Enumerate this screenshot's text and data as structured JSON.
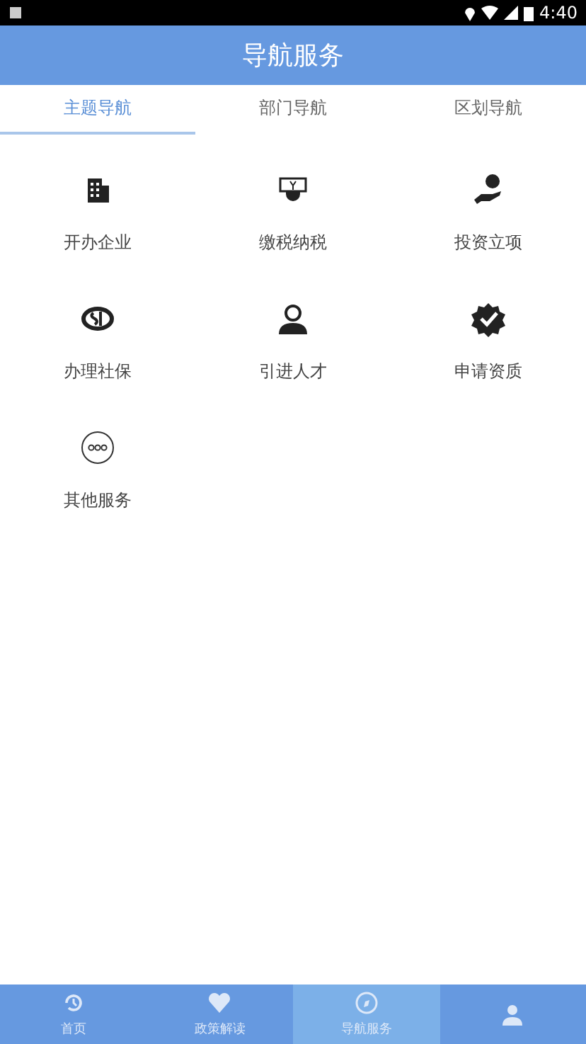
{
  "status_bar": {
    "time": "4:40"
  },
  "header": {
    "title": "导航服务"
  },
  "tabs": [
    {
      "label": "主题导航",
      "selected": true
    },
    {
      "label": "部门导航",
      "selected": false
    },
    {
      "label": "区划导航",
      "selected": false
    }
  ],
  "services": [
    {
      "label": "开办企业",
      "kind": "building"
    },
    {
      "label": "缴税纳税",
      "kind": "tax"
    },
    {
      "label": "投资立项",
      "kind": "invest"
    },
    {
      "label": "办理社保",
      "kind": "si"
    },
    {
      "label": "引进人才",
      "kind": "person"
    },
    {
      "label": "申请资质",
      "kind": "badge"
    },
    {
      "label": "其他服务",
      "kind": "more"
    }
  ],
  "bottom_nav": [
    {
      "label": "首页",
      "kind": "history",
      "selected": false
    },
    {
      "label": "政策解读",
      "kind": "heart",
      "selected": false
    },
    {
      "label": "导航服务",
      "kind": "compass",
      "selected": true
    },
    {
      "kind": "user",
      "selected": false
    }
  ]
}
